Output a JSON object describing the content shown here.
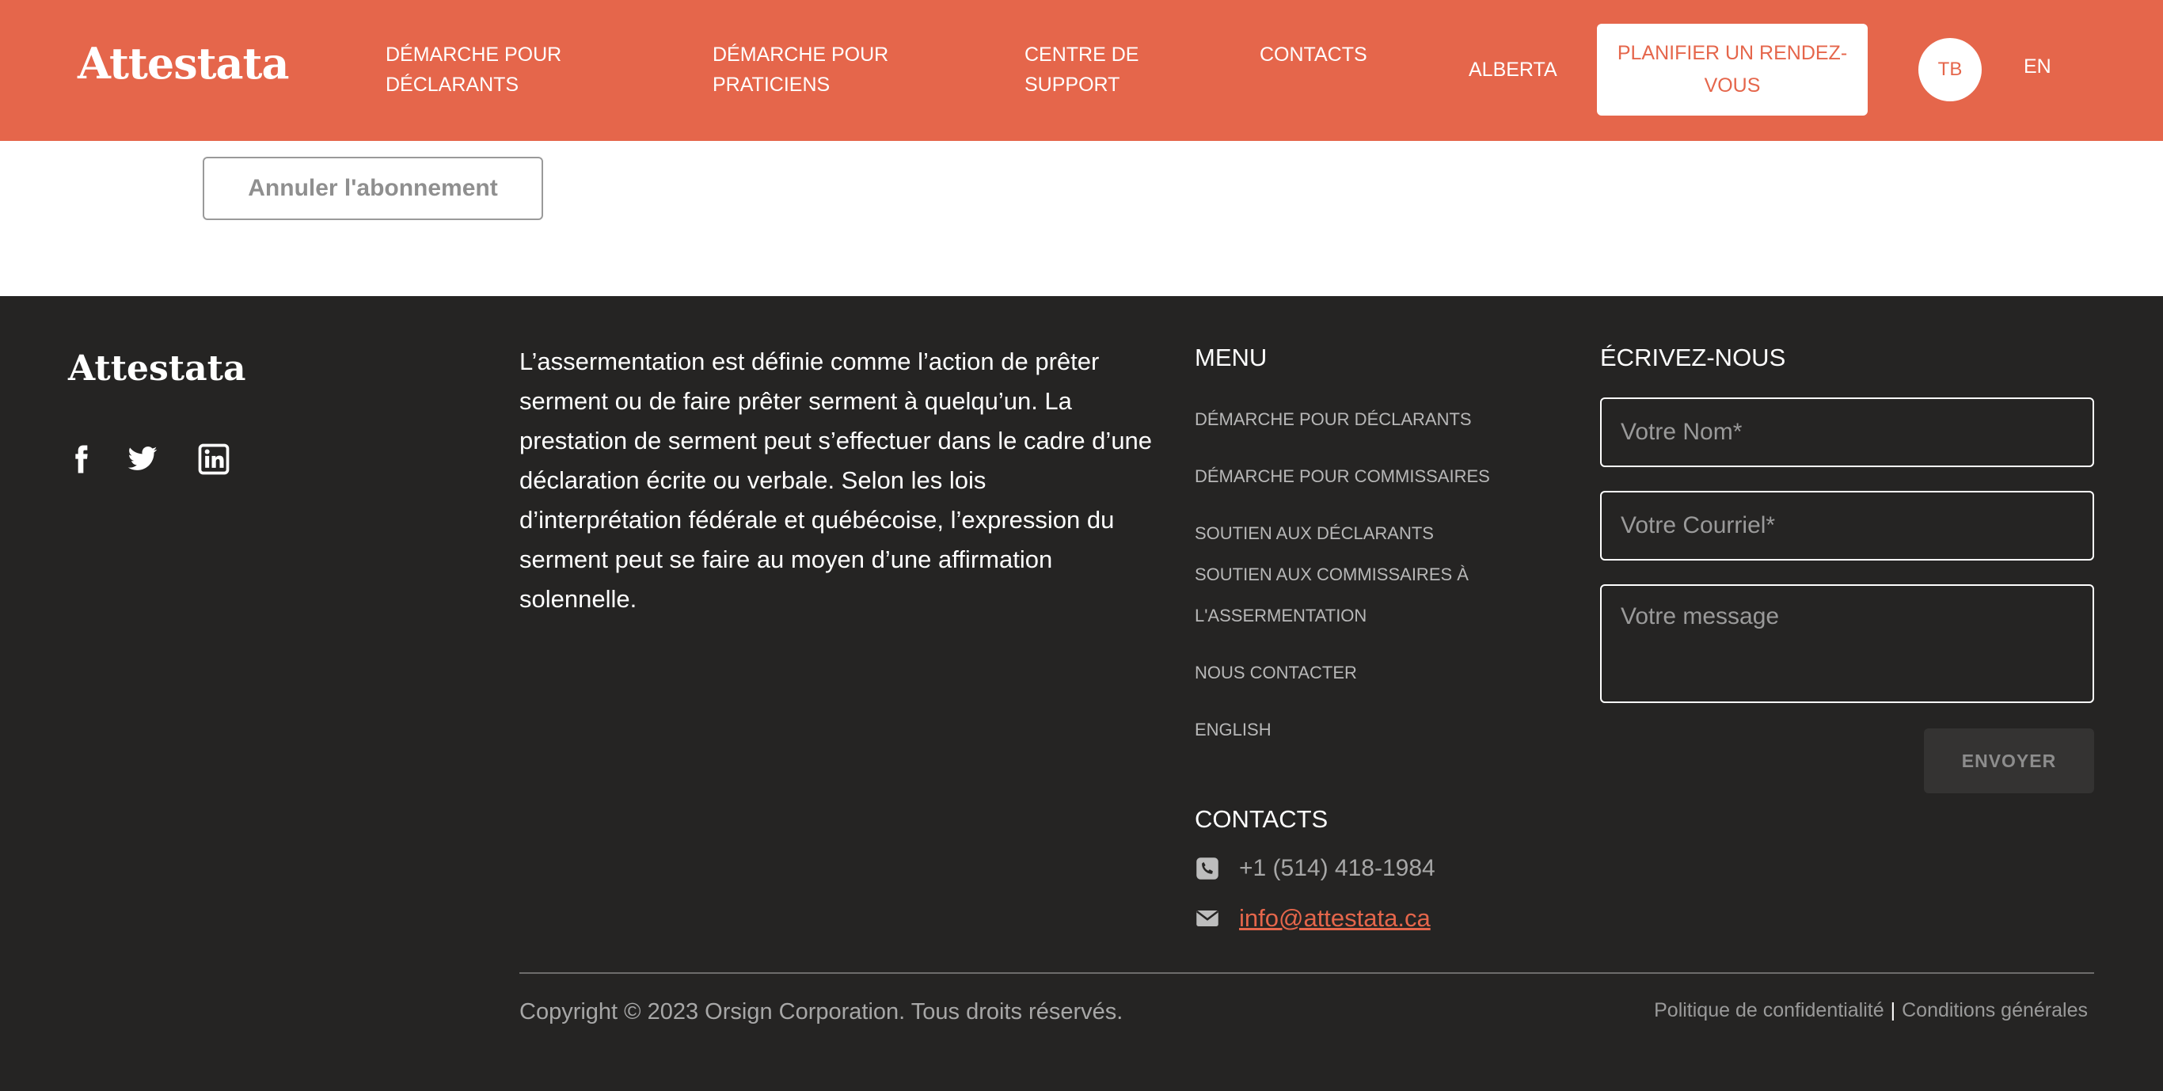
{
  "header": {
    "logo": "Attestata",
    "nav": [
      {
        "label": "DÉMARCHE POUR DÉCLARANTS"
      },
      {
        "label": "DÉMARCHE POUR PRATICIENS"
      },
      {
        "label": "CENTRE DE SUPPORT"
      },
      {
        "label": "CONTACTS"
      },
      {
        "label": "ALBERTA"
      }
    ],
    "cta_label": "PLANIFIER UN RENDEZ-VOUS",
    "avatar_initials": "TB",
    "language": "EN",
    "brand_color": "#e5664b"
  },
  "main": {
    "cancel_label": "Annuler l'abonnement"
  },
  "footer": {
    "logo": "Attestata",
    "social": [
      "facebook-icon",
      "twitter-icon",
      "linkedin-icon"
    ],
    "about": "L’assermentation est définie comme l’action de prêter serment ou de faire prêter serment à quelqu’un. La prestation de serment peut s’effectuer dans le cadre d’une déclaration écrite ou verbale. Selon les lois d’interprétation fédérale et québécoise, l’expression du serment peut se faire au moyen d’une affirmation solennelle.",
    "menu": {
      "title": "MENU",
      "items": [
        {
          "label": "DÉMARCHE POUR DÉCLARANTS"
        },
        {
          "label": "DÉMARCHE POUR COMMISSAIRES"
        },
        {
          "label": "SOUTIEN AUX DÉCLARANTS"
        },
        {
          "label": "SOUTIEN AUX COMMISSAIRES À L'ASSERMENTATION"
        },
        {
          "label": "NOUS CONTACTER"
        },
        {
          "label": "ENGLISH"
        }
      ]
    },
    "contacts": {
      "title": "CONTACTS",
      "phone": "+1 (514) 418-1984",
      "email": "info@attestata.ca"
    },
    "form": {
      "title": "ÉCRIVEZ-NOUS",
      "name_placeholder": "Votre Nom*",
      "email_placeholder": "Votre Courriel*",
      "message_placeholder": "Votre message",
      "submit_label": "ENVOYER"
    },
    "copyright": "Copyright © 2023 Orsign Corporation. Tous droits réservés.",
    "legal": {
      "privacy": "Politique de confidentialité",
      "separator": "|",
      "terms": "Conditions générales"
    }
  }
}
